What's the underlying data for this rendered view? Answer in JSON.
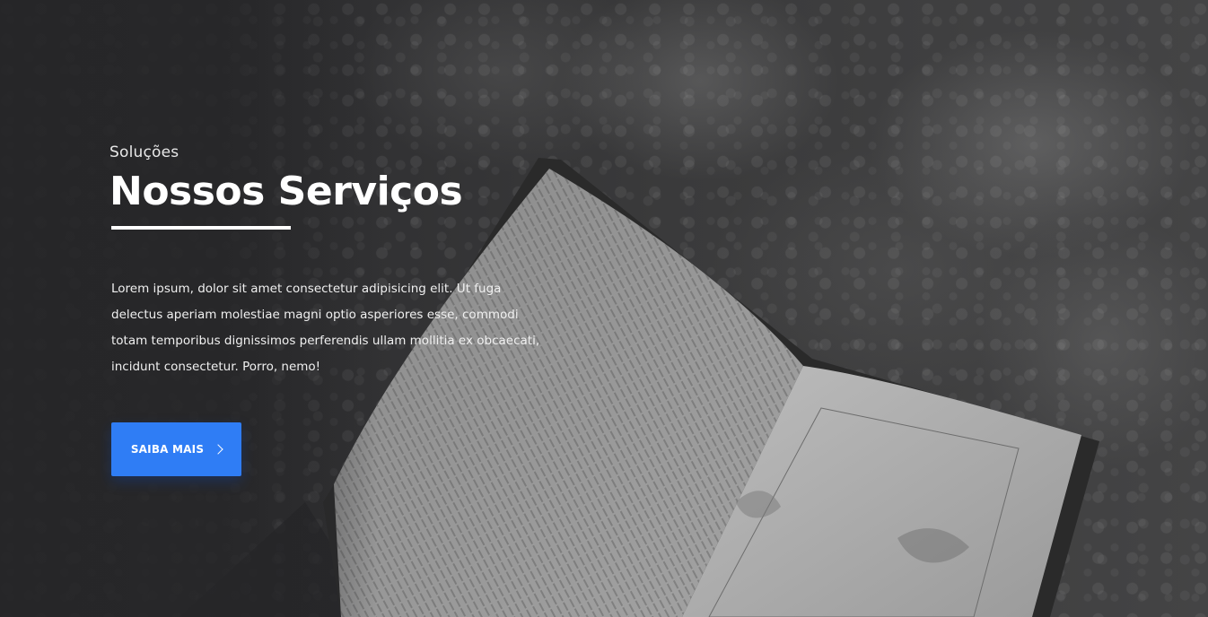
{
  "hero": {
    "eyebrow": "Soluções",
    "title": "Nossos Serviços",
    "paragraph": "Lorem ipsum, dolor sit amet consectetur adipisicing elit. Ut fuga delectus aperiam molestiae magni optio asperiores esse, commodi totam temporibus dignissimos perferendis ullam mollitia ex obcaecati, incidunt consectetur. Porro, nemo!",
    "cta_label": "SAIBA MAIS",
    "cta_icon": "chevron-right-icon",
    "background_image": "open-book-photo",
    "accent_color": "#2f7df5"
  }
}
